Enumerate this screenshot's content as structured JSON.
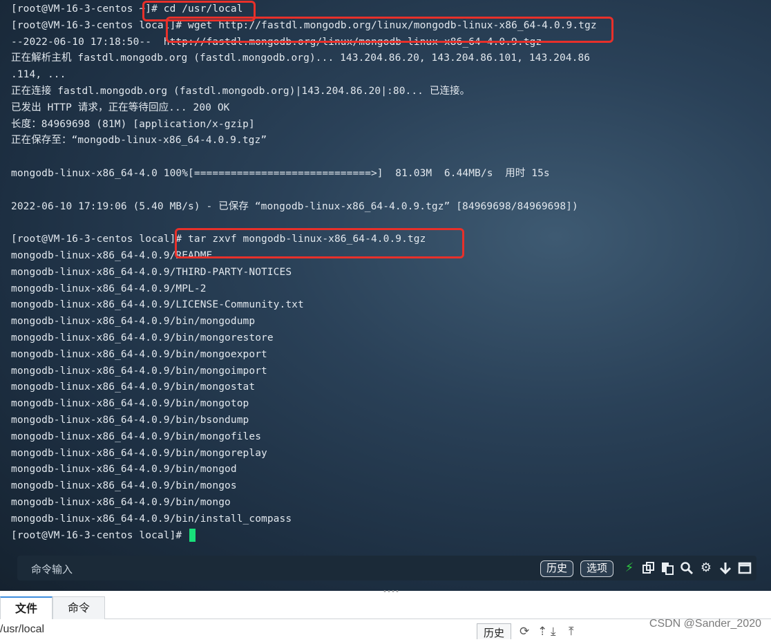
{
  "terminal": {
    "lines": [
      "[root@VM-16-3-centos ~]# cd /usr/local",
      "[root@VM-16-3-centos local]# wget http://fastdl.mongodb.org/linux/mongodb-linux-x86_64-4.0.9.tgz",
      "--2022-06-10 17:18:50--  http://fastdl.mongodb.org/linux/mongodb-linux-x86_64-4.0.9.tgz",
      "正在解析主机 fastdl.mongodb.org (fastdl.mongodb.org)... 143.204.86.20, 143.204.86.101, 143.204.86",
      ".114, ...",
      "正在连接 fastdl.mongodb.org (fastdl.mongodb.org)|143.204.86.20|:80... 已连接。",
      "已发出 HTTP 请求，正在等待回应... 200 OK",
      "长度：84969698 (81M) [application/x-gzip]",
      "正在保存至：“mongodb-linux-x86_64-4.0.9.tgz”",
      "",
      "mongodb-linux-x86_64-4.0 100%[=============================>]  81.03M  6.44MB/s  用时 15s",
      "",
      "2022-06-10 17:19:06 (5.40 MB/s) - 已保存 “mongodb-linux-x86_64-4.0.9.tgz” [84969698/84969698])",
      "",
      "[root@VM-16-3-centos local]# tar zxvf mongodb-linux-x86_64-4.0.9.tgz",
      "mongodb-linux-x86_64-4.0.9/README",
      "mongodb-linux-x86_64-4.0.9/THIRD-PARTY-NOTICES",
      "mongodb-linux-x86_64-4.0.9/MPL-2",
      "mongodb-linux-x86_64-4.0.9/LICENSE-Community.txt",
      "mongodb-linux-x86_64-4.0.9/bin/mongodump",
      "mongodb-linux-x86_64-4.0.9/bin/mongorestore",
      "mongodb-linux-x86_64-4.0.9/bin/mongoexport",
      "mongodb-linux-x86_64-4.0.9/bin/mongoimport",
      "mongodb-linux-x86_64-4.0.9/bin/mongostat",
      "mongodb-linux-x86_64-4.0.9/bin/mongotop",
      "mongodb-linux-x86_64-4.0.9/bin/bsondump",
      "mongodb-linux-x86_64-4.0.9/bin/mongofiles",
      "mongodb-linux-x86_64-4.0.9/bin/mongoreplay",
      "mongodb-linux-x86_64-4.0.9/bin/mongod",
      "mongodb-linux-x86_64-4.0.9/bin/mongos",
      "mongodb-linux-x86_64-4.0.9/bin/mongo",
      "mongodb-linux-x86_64-4.0.9/bin/install_compass"
    ],
    "prompt": "[root@VM-16-3-centos local]# "
  },
  "command_bar": {
    "input_placeholder": "命令输入",
    "history_label": "历史",
    "options_label": "选项",
    "icons": [
      "lightning-icon",
      "copy-icon",
      "paste-icon",
      "search-icon",
      "gear-icon",
      "arrow-down-icon",
      "maximize-icon"
    ]
  },
  "bottom_panel": {
    "tabs": [
      {
        "label": "文件",
        "active": true
      },
      {
        "label": "命令",
        "active": false
      }
    ],
    "path": "/usr/local",
    "history_label": "历史",
    "path_icons": [
      "refresh-icon",
      "up-icon",
      "download-icon",
      "upload-icon"
    ]
  },
  "watermark": "CSDN @Sander_2020",
  "colors": {
    "highlight_border": "#e8302a",
    "cursor": "#18e07a",
    "lightning": "#2ecc40"
  }
}
